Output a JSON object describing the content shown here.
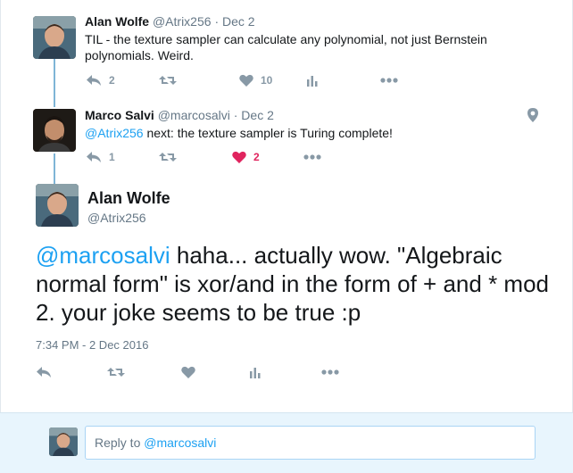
{
  "tweet1": {
    "name": "Alan Wolfe",
    "handle": "@Atrix256",
    "separator": "·",
    "time": "Dec 2",
    "text": "TIL - the texture sampler can calculate any polynomial, not just Bernstein polynomials. Weird.",
    "reply_count": "2",
    "retweet_count": "",
    "like_count": "10"
  },
  "tweet2": {
    "name": "Marco Salvi",
    "handle": "@marcosalvi",
    "separator": "·",
    "time": "Dec 2",
    "mention": "@Atrix256",
    "text": " next: the texture sampler is Turing complete!",
    "reply_count": "1",
    "retweet_count": "",
    "like_count": "2"
  },
  "main": {
    "name": "Alan Wolfe",
    "handle": "@Atrix256",
    "mention": "@marcosalvi",
    "text": " haha... actually wow. \"Algebraic normal form\" is xor/and in the form of + and * mod 2. your joke seems to be true :p",
    "timestamp": "7:34 PM - 2 Dec 2016"
  },
  "reply": {
    "prefix": "Reply to ",
    "mention": "@marcosalvi"
  },
  "colors": {
    "accent": "#1da1f2",
    "liked": "#e0245e",
    "thread_line": "#7fb5d6",
    "reply_bg": "#e8f5fd"
  }
}
